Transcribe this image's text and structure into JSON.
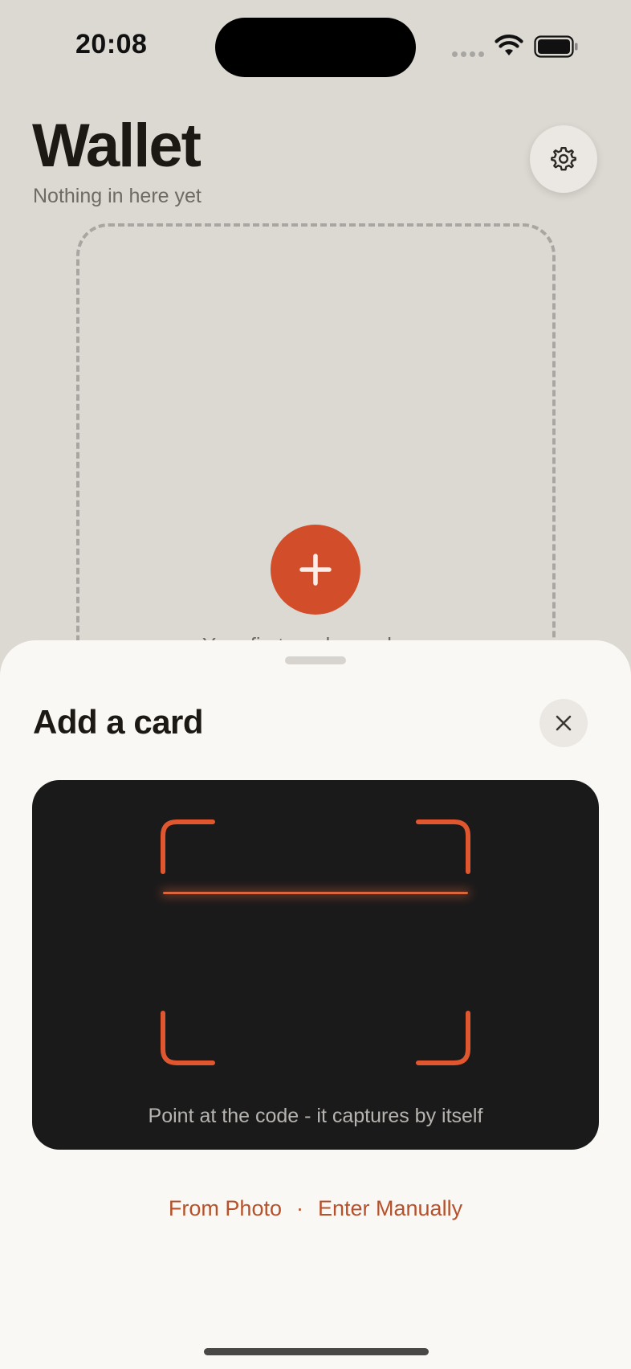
{
  "status_bar": {
    "time": "20:08",
    "icons": [
      "signal-icon",
      "wifi-icon",
      "battery-icon"
    ]
  },
  "wallet": {
    "title": "Wallet",
    "subtitle": "Nothing in here yet",
    "settings_icon": "gear-icon",
    "add_icon": "plus-icon",
    "placeholder_caption": "Your first card goes here"
  },
  "sheet": {
    "title": "Add a card",
    "close_icon": "close-icon",
    "scanner_hint": "Point at the code - it captures by itself",
    "actions": {
      "from_photo": "From Photo",
      "separator": "·",
      "enter_manually": "Enter Manually"
    }
  },
  "colors": {
    "background": "#dcd8d2",
    "sheet": "#faf8f4",
    "accent": "#d24e2b",
    "scanner": "#1b1a1b",
    "link": "#b7512b"
  }
}
